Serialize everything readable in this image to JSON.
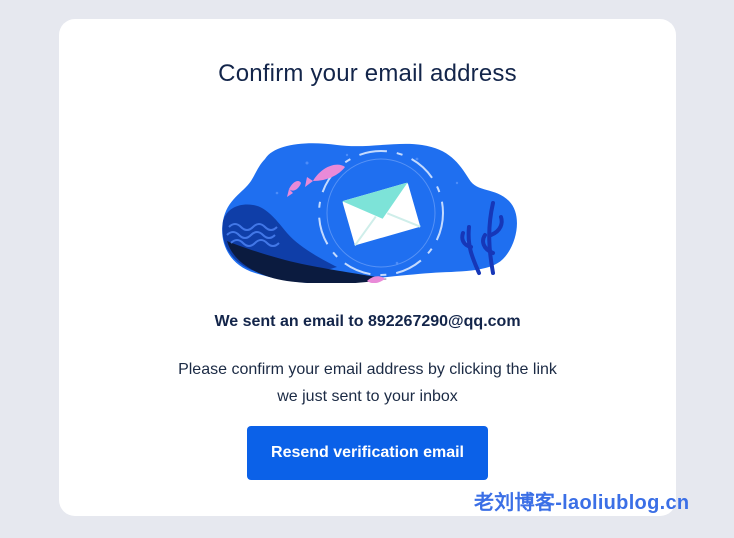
{
  "card": {
    "title": "Confirm your email address",
    "sent_line": "We sent an email to 892267290@qq.com",
    "body_line_1": "Please confirm your email address by clicking the link",
    "body_line_2": "we just sent to your inbox",
    "resend_button_label": "Resend verification email"
  },
  "illustration": {
    "icon": "envelope-icon"
  },
  "watermark": {
    "text": "老刘博客-laoliublog.cn"
  },
  "colors": {
    "background": "#e6e8ef",
    "card": "#ffffff",
    "title": "#13254a",
    "button": "#0b61e8",
    "illustration_blue": "#1f6ff0",
    "envelope": "#7de3d8",
    "fish": "#e98ad8",
    "watermark": "#3b6fe6"
  }
}
